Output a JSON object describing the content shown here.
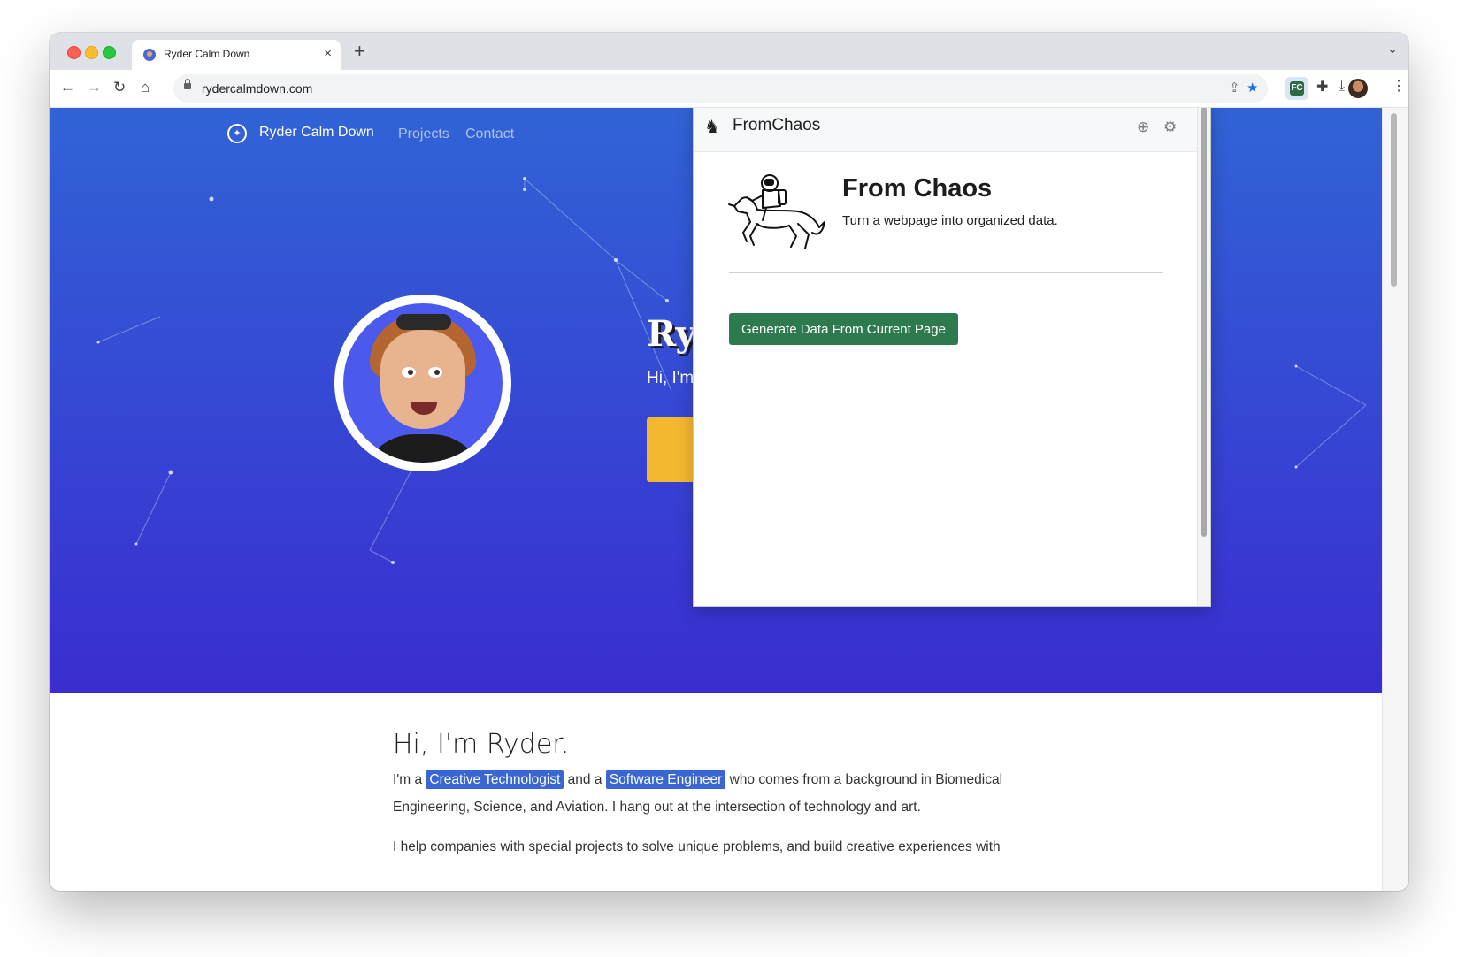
{
  "browser": {
    "tab_title": "Ryder Calm Down",
    "tab_close": "×",
    "new_tab": "+",
    "tab_search": "⌄",
    "url": "rydercalmdown.com",
    "nav": {
      "back": "←",
      "forward": "→",
      "reload": "↻",
      "home": "⌂"
    },
    "icons": {
      "share": "⇪",
      "bookmark": "★",
      "extensions": "✚",
      "download": "⤓",
      "sidepanel": "▮",
      "menu": "⋮"
    },
    "bookmark_color": "#1a73e8"
  },
  "site": {
    "brand": "Ryder Calm Down",
    "nav": [
      "Projects",
      "Contact"
    ],
    "hero_name": "Ryder",
    "hero_sub": "Hi, I'm Ry",
    "accent_color": "#f4b830",
    "about": {
      "heading": "Hi, I'm Ryder.",
      "p1_a": "I'm a",
      "p1_hl1": "Creative Technologist",
      "p1_b": "and a",
      "p1_hl2": "Software Engineer",
      "p1_c": "who comes from a background in Biomedical Engineering, Science, and Aviation. I hang out at the intersection of technology and art.",
      "p2": "I help companies with special projects to solve unique problems, and build creative experiences with"
    }
  },
  "extension": {
    "name": "FromChaos",
    "heading": "From Chaos",
    "tagline": "Turn a webpage into organized data.",
    "button": "Generate Data From Current Page",
    "add_icon": "⊕",
    "settings_icon": "⚙",
    "button_color": "#2e7a4f"
  }
}
